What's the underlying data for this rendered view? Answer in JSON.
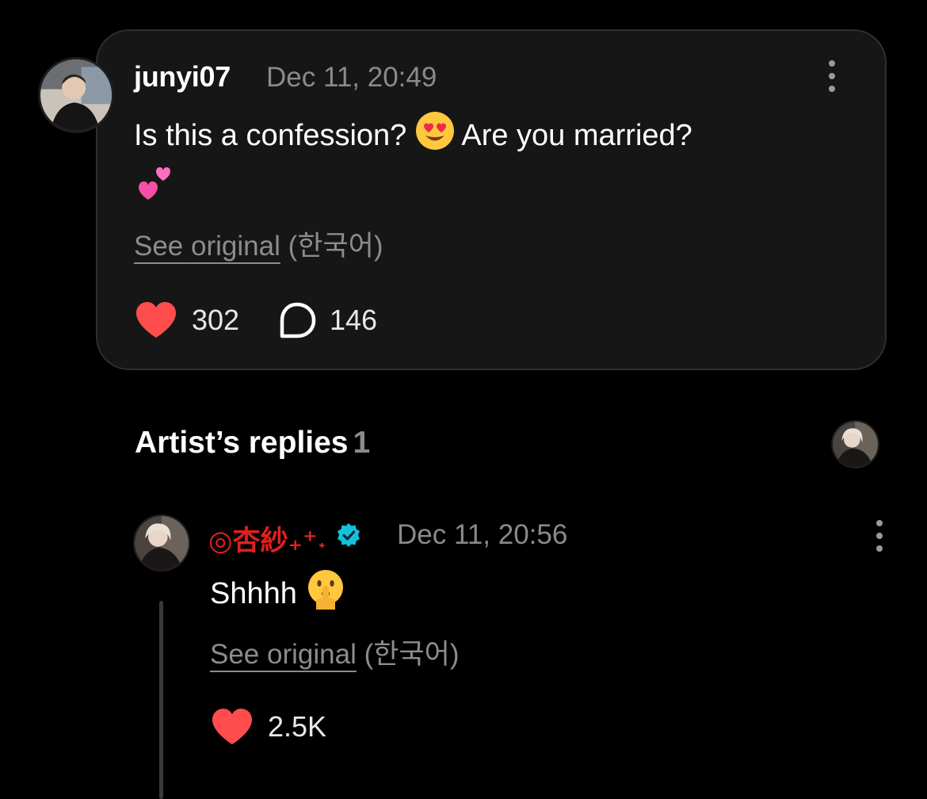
{
  "comment": {
    "username": "junyi07",
    "timestamp": "Dec 11, 20:49",
    "text_line1": "Is this a confession?",
    "text_mid": "Are you married?",
    "see_original": "See original",
    "language": "(한국어)",
    "likes": "302",
    "replies": "146",
    "icons": {
      "more": "more-vertical-icon",
      "like": "heart-icon",
      "reply": "speech-bubble-icon"
    }
  },
  "section": {
    "title": "Artist’s replies",
    "count": "1"
  },
  "reply": {
    "username": "◎杏紗₊⁺˖",
    "timestamp": "Dec 11, 20:56",
    "text": "Shhhh",
    "see_original": "See original",
    "language": "(한국어)",
    "likes": "2.5K"
  },
  "colors": {
    "background": "#000000",
    "card": "#161616",
    "heart": "#ff4d4d",
    "artist_name": "#e0201e",
    "verified": "#13c2d9",
    "muted_text": "#8a8a8a"
  }
}
